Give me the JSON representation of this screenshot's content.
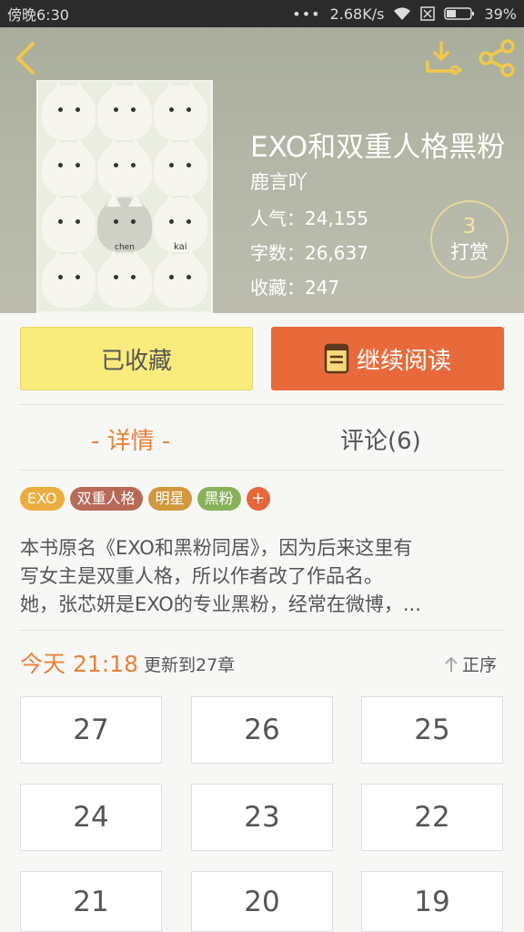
{
  "status_bar": {
    "time": "傍晚6:30",
    "speed": "2.68K/s",
    "battery": "39%"
  },
  "header": {
    "back_icon": "chevron-left-icon",
    "download_icon": "download-icon",
    "share_icon": "share-icon",
    "accent_color": "#f0c94a"
  },
  "book": {
    "title": "EXO和双重人格黑粉",
    "author": "鹿言吖",
    "popularity": "人气：24,155",
    "word_count": "字数：26,637",
    "favorites": "收藏：247",
    "tip_count": "3",
    "tip_label": "打赏",
    "cover_captions": [
      "kai",
      "chen"
    ]
  },
  "actions": {
    "favorited_label": "已收藏",
    "continue_label": "继续阅读"
  },
  "tabs": {
    "detail": "- 详情 -",
    "comments": "评论(6)"
  },
  "tags": [
    {
      "label": "EXO",
      "color": "#ecad3f"
    },
    {
      "label": "双重人格",
      "color": "#b86a56"
    },
    {
      "label": "明星",
      "color": "#d1983e"
    },
    {
      "label": "黑粉",
      "color": "#88b25a"
    }
  ],
  "tag_add": "+",
  "description": [
    "本书原名《EXO和黑粉同居》，因为后来这里有",
    "写女主是双重人格，所以作者改了作品名。",
    "她，张芯妍是EXO的专业黑粉，经常在微博，..."
  ],
  "update": {
    "date": "今天 21:18",
    "text": "更新到27章",
    "sort_label": "正序"
  },
  "chapters": [
    "27",
    "26",
    "25",
    "24",
    "23",
    "22",
    "21",
    "20",
    "19"
  ]
}
